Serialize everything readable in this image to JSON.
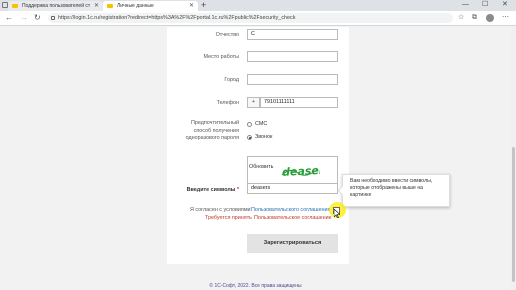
{
  "browser": {
    "tabs": [
      {
        "label": "Поддержка пользователей ст",
        "favicon_color": "#f5c400"
      },
      {
        "label": "Личные данные",
        "favicon_color": "#f5c400"
      }
    ],
    "new_tab": "+",
    "url": "https://login.1c.ru/registration?redirect=https%3A%2F%2Fportal.1c.ru%2Fpublic%2Fsecurity_check",
    "window": {
      "minimize": "—",
      "maximize": "☐",
      "close": "✕"
    }
  },
  "form": {
    "patronymic": {
      "label": "Отчество",
      "value": "С"
    },
    "workplace": {
      "label": "Место работы",
      "value": ""
    },
    "city": {
      "label": "Город",
      "value": ""
    },
    "phone": {
      "label": "Телефон",
      "prefix": "+",
      "value": "79101111111"
    },
    "otp": {
      "label_lines": [
        "Предпочтительный",
        "способ получения",
        "одноразового пароля"
      ],
      "options": [
        {
          "label": "СМС",
          "selected": false
        },
        {
          "label": "Звонок",
          "selected": true
        }
      ]
    },
    "captcha": {
      "refresh": "Обновить",
      "image_text": "deasers"
    },
    "captcha_input": {
      "label": "Введите символы",
      "required_mark": "*",
      "value": "deasers"
    },
    "tooltip": "Вам необходимо ввести символы, которые отображены выше на картинке",
    "agreement": {
      "text": "Я согласен с условиями",
      "link": "Пользовательского соглашения"
    },
    "warning": {
      "text": "Требуется принять",
      "link": "Пользовательское соглашение"
    },
    "submit": "Зарегистрироваться"
  },
  "footer": "© 1С-Софт, 2022. Все права защищены",
  "colors": {
    "accent": "#2a6fb5",
    "warning": "#c0392b",
    "highlight": "#ffeb00"
  }
}
